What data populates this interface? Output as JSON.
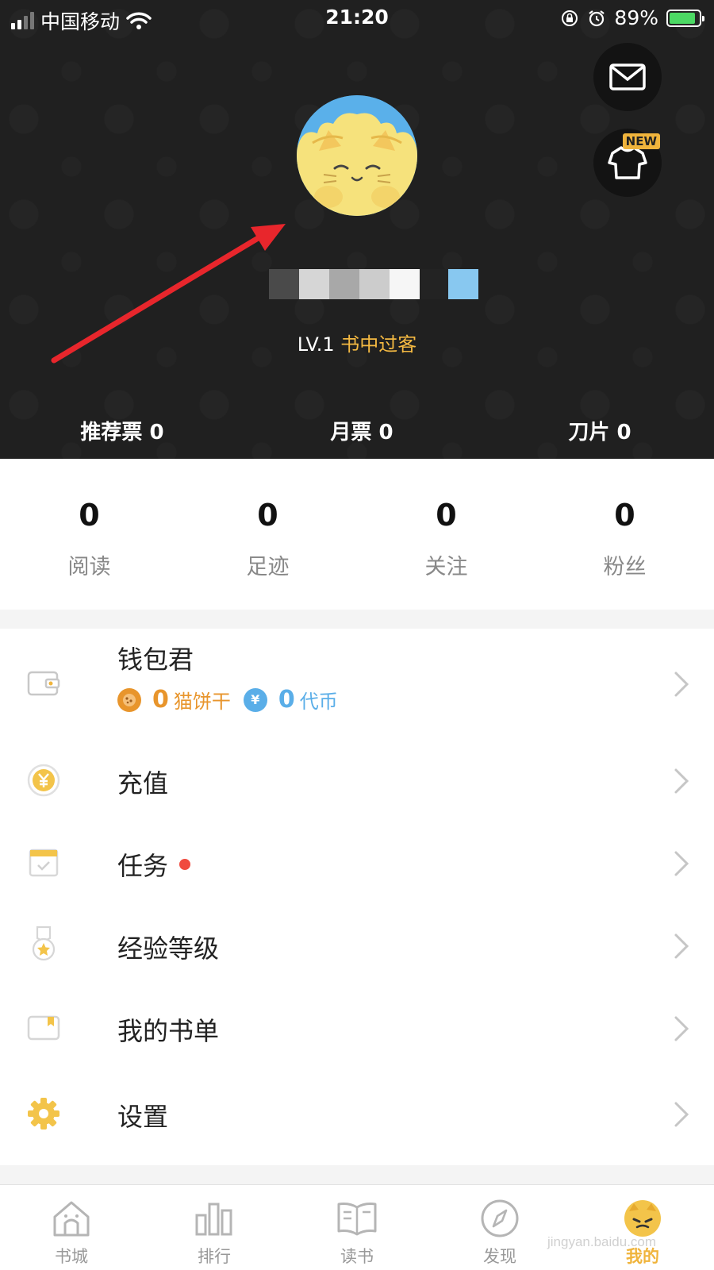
{
  "status_bar": {
    "carrier": "中国移动",
    "time": "21:20",
    "battery": "89%",
    "battery_level": 0.89
  },
  "header": {
    "level": "LV.1",
    "level_name": "书中过客",
    "tickets": [
      {
        "label": "推荐票",
        "value": "0"
      },
      {
        "label": "月票",
        "value": "0"
      },
      {
        "label": "刀片",
        "value": "0"
      }
    ],
    "new_badge": "NEW",
    "icons": {
      "mail": "mail-icon",
      "shirt": "shirt-icon"
    }
  },
  "stats": [
    {
      "value": "0",
      "label": "阅读"
    },
    {
      "value": "0",
      "label": "足迹"
    },
    {
      "value": "0",
      "label": "关注"
    },
    {
      "value": "0",
      "label": "粉丝"
    }
  ],
  "menu": {
    "wallet": {
      "label": "钱包君",
      "cookie_value": "0",
      "cookie_label": "猫饼干",
      "coin_value": "0",
      "coin_label": "代币",
      "coin_symbol": "¥"
    },
    "items": [
      {
        "label": "充值",
        "icon": "yuan-coin-icon"
      },
      {
        "label": "任务",
        "icon": "calendar-check-icon"
      },
      {
        "label": "经验等级",
        "icon": "medal-icon"
      },
      {
        "label": "我的书单",
        "icon": "booklist-icon"
      },
      {
        "label": "设置",
        "icon": "gear-icon"
      }
    ]
  },
  "tabbar": [
    {
      "label": "书城",
      "icon": "bookstore-icon"
    },
    {
      "label": "排行",
      "icon": "ranking-icon"
    },
    {
      "label": "读书",
      "icon": "open-book-icon"
    },
    {
      "label": "发现",
      "icon": "compass-icon"
    },
    {
      "label": "我的",
      "icon": "cat-avatar-icon",
      "active": true
    }
  ],
  "watermark": "jingyan.baidu.com",
  "colors": {
    "accent_gold": "#f0b43c",
    "cookie_orange": "#e8952c",
    "coin_blue": "#5aaee8",
    "header_bg": "#202020",
    "red_dot": "#f04a3e"
  }
}
